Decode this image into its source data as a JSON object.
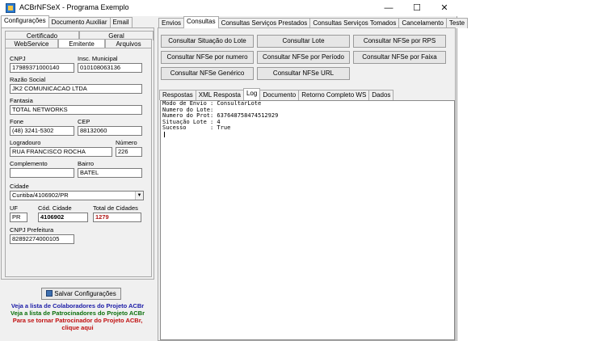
{
  "window": {
    "title": "ACBrNFSeX - Programa Exemplo"
  },
  "left_tabs": [
    {
      "label": "Configurações",
      "active": true
    },
    {
      "label": "Documento Auxiliar",
      "active": false
    },
    {
      "label": "Email",
      "active": false
    }
  ],
  "config_subtabs_row1": [
    "Certificado",
    "Geral"
  ],
  "config_subtabs_row2": [
    "WebService",
    "Emitente",
    "Arquivos"
  ],
  "emitente": {
    "cnpj_label": "CNPJ",
    "cnpj": "17989371000140",
    "im_label": "Insc. Municipal",
    "im": "010108063136",
    "razao_label": "Razão Social",
    "razao": "JK2 COMUNICACAO LTDA",
    "fantasia_label": "Fantasia",
    "fantasia": "TOTAL NETWORKS",
    "fone_label": "Fone",
    "fone": "(48) 3241-5302",
    "cep_label": "CEP",
    "cep": "88132060",
    "logradouro_label": "Logradouro",
    "logradouro": "RUA FRANCISCO ROCHA",
    "numero_label": "Número",
    "numero": "226",
    "complemento_label": "Complemento",
    "complemento": "",
    "bairro_label": "Bairro",
    "bairro": "BATEL",
    "cidade_label": "Cidade",
    "cidade": "Curitiba/4106902/PR",
    "uf_label": "UF",
    "uf": "PR",
    "cod_cidade_label": "Cód. Cidade",
    "cod_cidade": "4106902",
    "total_cidades_label": "Total de Cidades",
    "total_cidades": "1279",
    "cnpj_pref_label": "CNPJ Prefeitura",
    "cnpj_pref": "82892274000105"
  },
  "save_button": "Salvar Configurações",
  "links": {
    "colaboradores": "Veja a lista de Colaboradores do Projeto ACBr",
    "patrocinadores": "Veja a lista de Patrocinadores do Projeto ACBr",
    "patrocinador1": "Para se tornar Patrocinador do Projeto ACBr,",
    "patrocinador2": "clique aqui"
  },
  "right_tabs": [
    {
      "label": "Envios",
      "active": false
    },
    {
      "label": "Consultas",
      "active": true
    },
    {
      "label": "Consultas Serviços Prestados",
      "active": false
    },
    {
      "label": "Consultas Serviços Tomados",
      "active": false
    },
    {
      "label": "Cancelamento",
      "active": false
    },
    {
      "label": "Teste",
      "active": false
    }
  ],
  "consultas_buttons": [
    "Consultar Situação do Lote",
    "Consultar Lote",
    "Consultar NFSe por RPS",
    "Consultar NFSe por numero",
    "Consultar NFSe por Período",
    "Consultar NFSe por Faixa",
    "Consultar NFSe Genérico",
    "Consultar NFSe URL"
  ],
  "response_tabs": [
    {
      "label": "Respostas",
      "active": false
    },
    {
      "label": "XML Resposta",
      "active": false
    },
    {
      "label": "Log",
      "active": true
    },
    {
      "label": "Documento",
      "active": false
    },
    {
      "label": "Retorno Completo WS",
      "active": false
    },
    {
      "label": "Dados",
      "active": false
    }
  ],
  "log_lines": [
    "Modo de Envio : ConsultarLote",
    "Numero do Lote:",
    "Numero do Prot: 637648758474512929",
    "Situação Lote : 4",
    "Sucesso       : True"
  ]
}
